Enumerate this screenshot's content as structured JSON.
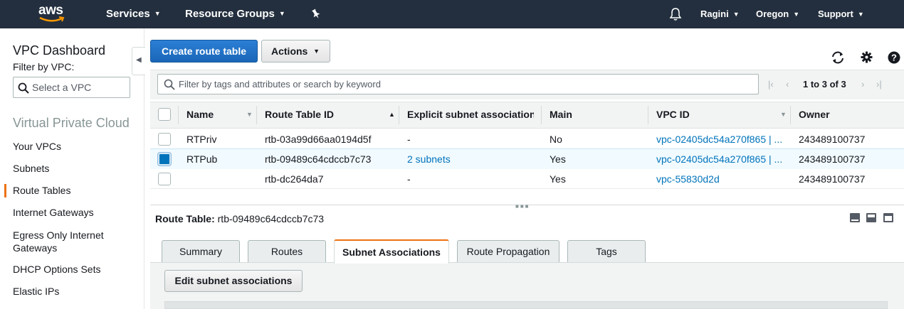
{
  "topnav": {
    "logo_text": "aws",
    "services": "Services",
    "resource_groups": "Resource Groups",
    "user": "Ragini",
    "region": "Oregon",
    "support": "Support"
  },
  "sidebar": {
    "title": "VPC Dashboard",
    "filter_label": "Filter by VPC:",
    "vpc_select_placeholder": "Select a VPC",
    "section": "Virtual Private Cloud",
    "items": [
      {
        "label": "Your VPCs",
        "active": false
      },
      {
        "label": "Subnets",
        "active": false
      },
      {
        "label": "Route Tables",
        "active": true
      },
      {
        "label": "Internet Gateways",
        "active": false
      },
      {
        "label": "Egress Only Internet Gateways",
        "active": false
      },
      {
        "label": "DHCP Options Sets",
        "active": false
      },
      {
        "label": "Elastic IPs",
        "active": false
      }
    ]
  },
  "toolbar": {
    "create_label": "Create route table",
    "actions_label": "Actions",
    "icons": [
      "refresh-icon",
      "gear-icon",
      "help-icon"
    ]
  },
  "search": {
    "placeholder": "Filter by tags and attributes or search by keyword"
  },
  "pager": {
    "count": "1 to 3 of 3"
  },
  "table": {
    "columns": [
      "Name",
      "Route Table ID",
      "Explicit subnet association",
      "Main",
      "VPC ID",
      "Owner"
    ],
    "rows": [
      {
        "selected": false,
        "name": "RTPriv",
        "id": "rtb-03a99d66aa0194d5f",
        "subnets": "-",
        "main": "No",
        "vpc": "vpc-02405dc54a270f865 | ...",
        "owner": "243489100737"
      },
      {
        "selected": true,
        "name": "RTPub",
        "id": "rtb-09489c64cdccb7c73",
        "subnets": "2 subnets",
        "main": "Yes",
        "vpc": "vpc-02405dc54a270f865 | ...",
        "owner": "243489100737"
      },
      {
        "selected": false,
        "name": "",
        "id": "rtb-dc264da7",
        "subnets": "-",
        "main": "Yes",
        "vpc": "vpc-55830d2d",
        "owner": "243489100737"
      }
    ]
  },
  "detail": {
    "label": "Route Table:",
    "value": "rtb-09489c64cdccb7c73",
    "tabs": [
      {
        "label": "Summary",
        "active": false
      },
      {
        "label": "Routes",
        "active": false
      },
      {
        "label": "Subnet Associations",
        "active": true
      },
      {
        "label": "Route Propagation",
        "active": false
      },
      {
        "label": "Tags",
        "active": false
      }
    ],
    "edit_label": "Edit subnet associations"
  },
  "colors": {
    "nav_bg": "#232f3e",
    "primary": "#1f6fc5",
    "accent": "#ec7211",
    "link": "#0073bb"
  }
}
